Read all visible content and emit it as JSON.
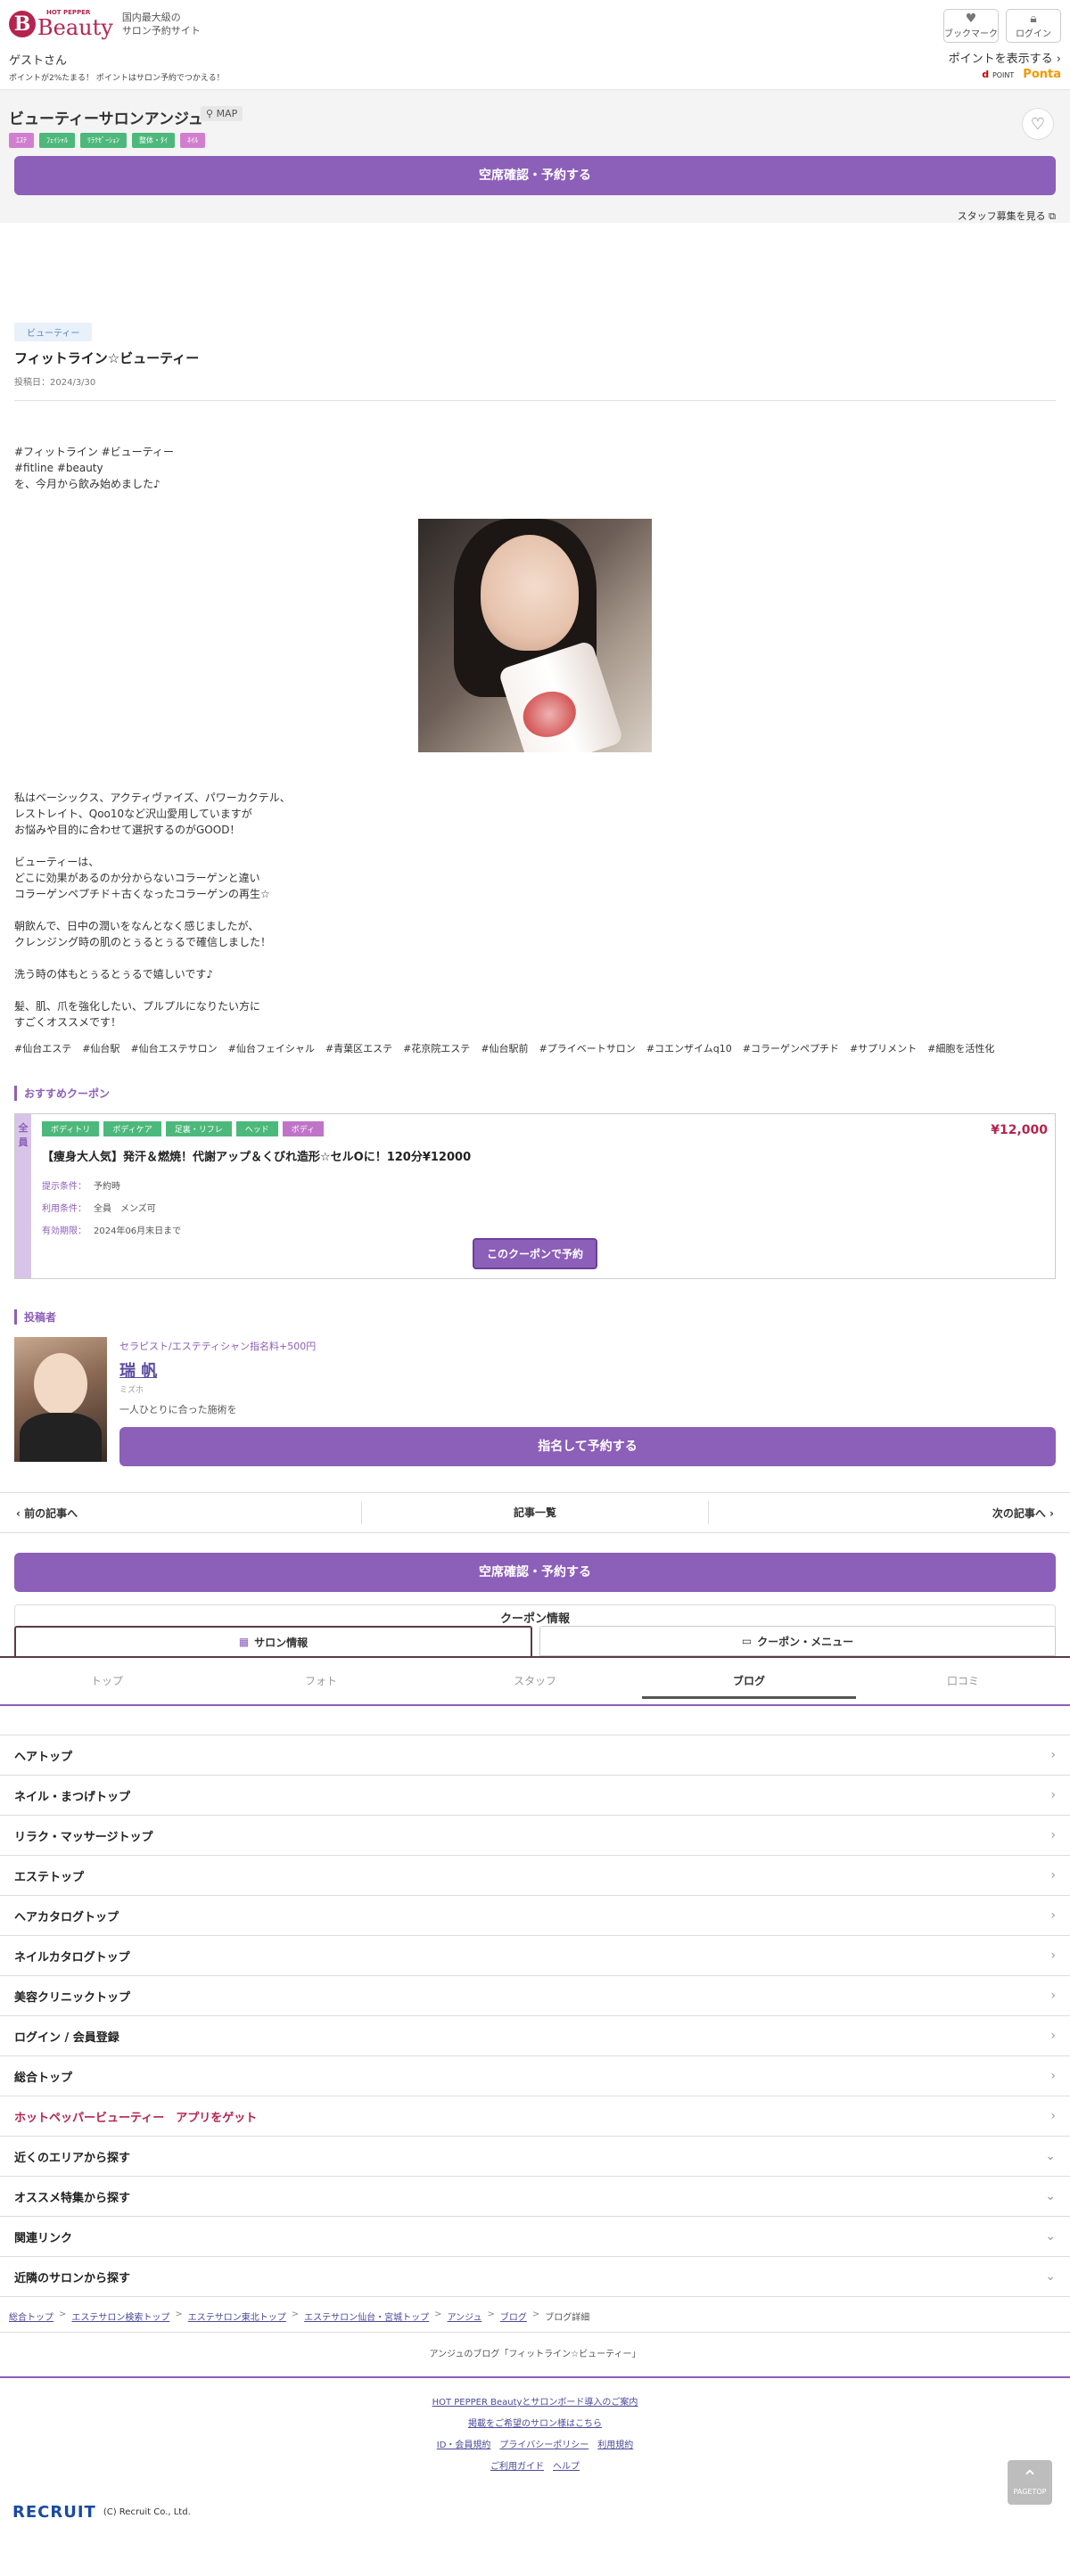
{
  "header": {
    "logo_hp": "HOT PEPPER",
    "logo_beauty": "Beauty",
    "tagline_1": "国内最大級の",
    "tagline_2": "サロン予約サイト",
    "bookmark_label": "ブックマーク",
    "login_label": "ログイン",
    "guest": "ゲストさん",
    "point_note": "ポイントが2%たまる！ ポイントはサロン予約でつかえる！",
    "show_point": "ポイントを表示する",
    "dpoint": "d",
    "dpoint_small": "POINT",
    "ponta": "Ponta"
  },
  "salon": {
    "name": "ビューティーサロンアンジュ",
    "map": "MAP",
    "tags": [
      {
        "label": "ｴｽﾃ",
        "color": "#d07fcf"
      },
      {
        "label": "ﾌｪｲｼｬﾙ",
        "color": "#4db87b"
      },
      {
        "label": "ﾘﾗｸｾﾞｰｼｮﾝ",
        "color": "#4db87b"
      },
      {
        "label": "整体・ﾀｲ",
        "color": "#4db87b"
      },
      {
        "label": "ﾈｲﾙ",
        "color": "#d07fcf"
      }
    ],
    "reserve_button": "空席確認・予約する",
    "staff_recruit": "スタッフ募集を見る"
  },
  "blog": {
    "category": "ビューティー",
    "title": "フィットライン☆ビューティー",
    "date": "投稿日：2024/3/30",
    "intro": [
      "#フィットライン #ビューティー",
      "#fitline #beauty",
      "を、今月から飲み始めました♪"
    ],
    "body": "私はベーシックス、アクティヴァイズ、パワーカクテル、\nレストレイト、Qoo10など沢山愛用していますが\nお悩みや目的に合わせて選択するのがGOOD！\n\nビューティーは、\nどこに効果があるのか分からないコラーゲンと違い\nコラーゲンペプチド＋古くなったコラーゲンの再生☆\n\n朝飲んで、日中の潤いをなんとなく感じましたが、\nクレンジング時の肌のとぅるとぅるで確信しました！\n\n洗う時の体もとぅるとぅるで嬉しいです♪\n\n髪、肌、爪を強化したい、プルプルになりたい方に\nすごくオススメです！",
    "hashtags": [
      "#仙台エステ",
      "#仙台駅",
      "#仙台エステサロン",
      "#仙台フェイシャル",
      "#青葉区エステ",
      "#花京院エステ",
      "#仙台駅前",
      "#プライベートサロン",
      "#コエンザイムq10",
      "#コラーゲンペプチド",
      "#サプリメント",
      "#細胞を活性化"
    ]
  },
  "coupon_section": {
    "heading": "おすすめクーポン",
    "side_label": "全員",
    "tags": [
      {
        "label": "ボディトリ",
        "pink": false
      },
      {
        "label": "ボディケア",
        "pink": false
      },
      {
        "label": "足裏・リフレ",
        "pink": false
      },
      {
        "label": "ヘッド",
        "pink": false
      },
      {
        "label": "ボディ",
        "pink": true
      }
    ],
    "price": "¥12,000",
    "title": "【痩身大人気】発汗＆燃焼！代謝アップ＆くびれ造形☆セルOに！120分¥12000",
    "cond_label_1": "提示条件：",
    "cond_value_1": "予約時",
    "cond_label_2": "利用条件：",
    "cond_value_2": "全員　メンズ可",
    "cond_label_3": "有効期限：",
    "cond_value_3": "2024年06月末日まで",
    "button": "このクーポンで予約"
  },
  "poster_section": {
    "heading": "投稿者",
    "role": "セラピスト/エステティシャン指名料+500円",
    "name": "瑞 帆",
    "kana": "ミズホ",
    "message": "一人ひとりに合った施術を",
    "button": "指名して予約する"
  },
  "pager": {
    "prev": "前の記事へ",
    "list": "記事一覧",
    "next": "次の記事へ"
  },
  "reserve_button_2": "空席確認・予約する",
  "coupon_info": "クーポン情報",
  "main_tabs": {
    "salon_info": "サロン情報",
    "coupon_menu": "クーポン・メニュー"
  },
  "sub_tabs": [
    "トップ",
    "フォト",
    "スタッフ",
    "ブログ",
    "口コミ"
  ],
  "nav": [
    {
      "label": "ヘアトップ",
      "arrow": "›"
    },
    {
      "label": "ネイル・まつげトップ",
      "arrow": "›"
    },
    {
      "label": "リラク・マッサージトップ",
      "arrow": "›"
    },
    {
      "label": "エステトップ",
      "arrow": "›"
    },
    {
      "label": "ヘアカタログトップ",
      "arrow": "›"
    },
    {
      "label": "ネイルカタログトップ",
      "arrow": "›"
    },
    {
      "label": "美容クリニックトップ",
      "arrow": "›"
    },
    {
      "label": "ログイン / 会員登録",
      "arrow": "›"
    },
    {
      "label": "総合トップ",
      "arrow": "›"
    },
    {
      "label": "ホットペッパービューティー　アプリをゲット",
      "arrow": "›",
      "app": true
    },
    {
      "label": "近くのエリアから探す",
      "arrow": "⌄"
    },
    {
      "label": "オススメ特集から探す",
      "arrow": "⌄"
    },
    {
      "label": "関連リンク",
      "arrow": "⌄"
    },
    {
      "label": "近隣のサロンから探す",
      "arrow": "⌄"
    }
  ],
  "breadcrumbs": [
    "総合トップ",
    "エステサロン検索トップ",
    "エステサロン東北トップ",
    "エステサロン仙台・宮城トップ",
    "アンジュ",
    "ブログ",
    "ブログ詳細"
  ],
  "page_desc": "アンジュのブログ「フィットライン☆ビューティー」",
  "footer": {
    "line1": [
      "HOT PEPPER Beautyとサロンボード導入のご案内"
    ],
    "line2": [
      "掲載をご希望のサロン様はこちら"
    ],
    "line3": [
      "ID・会員規約",
      "プライバシーポリシー",
      "利用規約"
    ],
    "line4": [
      "ご利用ガイド",
      "ヘルプ"
    ],
    "recruit": "RECRUIT",
    "copyright": "(C) Recruit Co., Ltd.",
    "pagetop": "PAGETOP"
  }
}
